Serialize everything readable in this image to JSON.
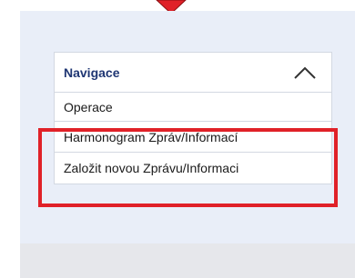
{
  "navigation": {
    "title": "Navigace",
    "toggle_icon": "chevron-up-icon",
    "items": [
      {
        "label": "Operace"
      },
      {
        "label": "Harmonogram Zpráv/Informací"
      },
      {
        "label": "Založit novou Zprávu/Informaci"
      }
    ]
  },
  "annotation": {
    "highlight_color": "#e02128",
    "pointer_icon": "red-arrow-pointer-icon"
  }
}
